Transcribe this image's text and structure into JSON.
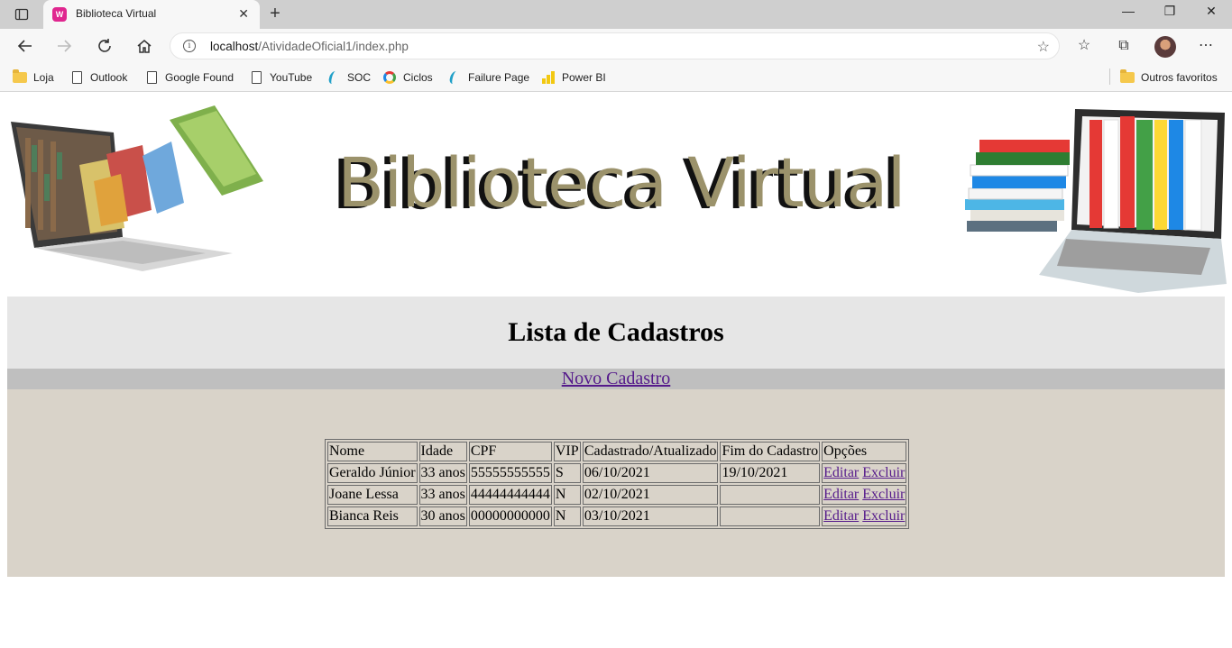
{
  "browser": {
    "tab_title": "Biblioteca Virtual",
    "url_host": "localhost",
    "url_path": "/AtividadeOficial1/index.php",
    "bookmarks": [
      {
        "label": "Loja",
        "icon": "folder-icon"
      },
      {
        "label": "Outlook",
        "icon": "page-icon"
      },
      {
        "label": "Google Found",
        "icon": "page-icon"
      },
      {
        "label": "YouTube",
        "icon": "page-icon"
      },
      {
        "label": "SOC",
        "icon": "soc-icon"
      },
      {
        "label": "Ciclos",
        "icon": "ciclos-icon"
      },
      {
        "label": "Failure Page",
        "icon": "soc-icon"
      },
      {
        "label": "Power BI",
        "icon": "powerbi-icon"
      }
    ],
    "other_favorites": "Outros favoritos"
  },
  "page": {
    "banner_title": "Biblioteca Virtual",
    "heading": "Lista de Cadastros",
    "new_link": "Novo Cadastro"
  },
  "table": {
    "headers": [
      "Nome",
      "Idade",
      "CPF",
      "VIP",
      "Cadastrado/Atualizado",
      "Fim do Cadastro",
      "Opções"
    ],
    "rows": [
      {
        "nome": "Geraldo Júnior",
        "idade": "33 anos",
        "cpf": "55555555555",
        "vip": "S",
        "cadastrado": "06/10/2021",
        "fim": "19/10/2021",
        "editar": "Editar",
        "excluir": "Excluir"
      },
      {
        "nome": "Joane Lessa",
        "idade": "33 anos",
        "cpf": "44444444444",
        "vip": "N",
        "cadastrado": "02/10/2021",
        "fim": "",
        "editar": "Editar",
        "excluir": "Excluir"
      },
      {
        "nome": "Bianca Reis",
        "idade": "30 anos",
        "cpf": "00000000000",
        "vip": "N",
        "cadastrado": "03/10/2021",
        "fim": "",
        "editar": "Editar",
        "excluir": "Excluir"
      }
    ]
  }
}
